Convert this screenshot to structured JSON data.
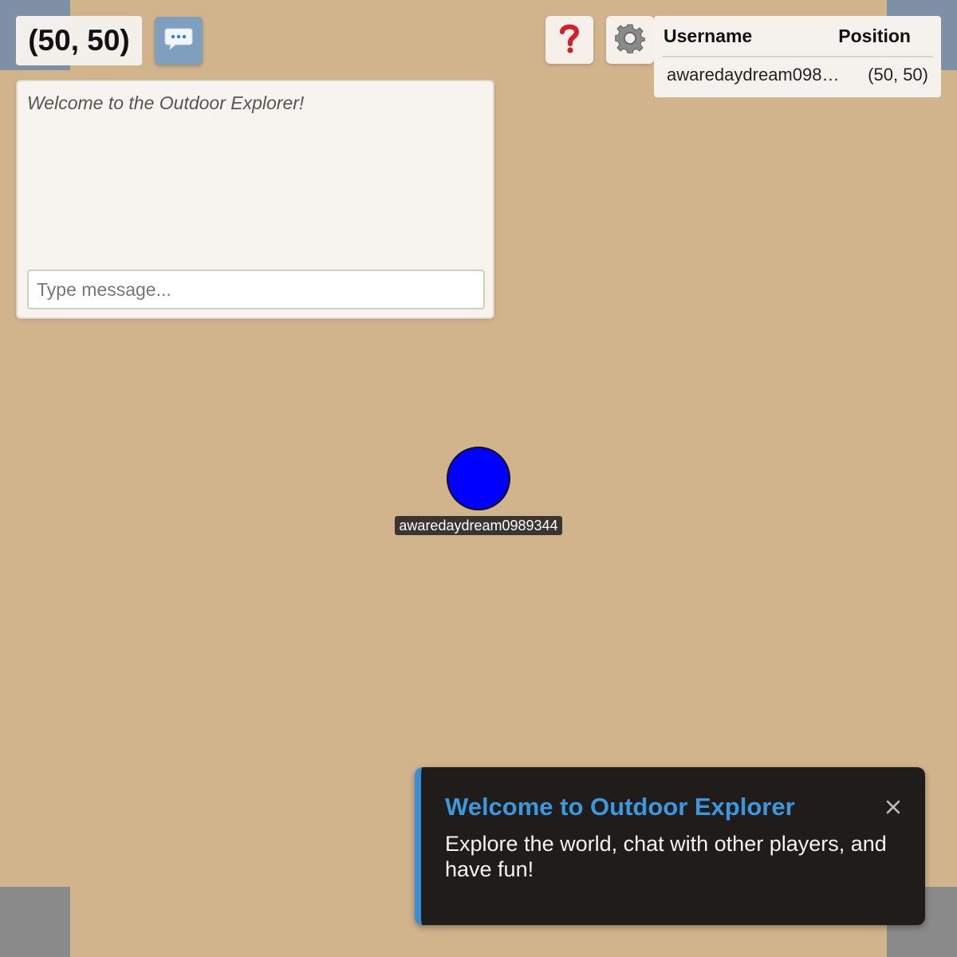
{
  "hud": {
    "coordinates": "(50, 50)"
  },
  "icons": {
    "chat": "chat-bubble-icon",
    "help": "question-mark-icon",
    "settings": "gear-icon",
    "close": "close-icon"
  },
  "players_table": {
    "headers": {
      "username": "Username",
      "position": "Position"
    },
    "rows": [
      {
        "username": "awaredaydream0989344",
        "position": "(50, 50)"
      }
    ]
  },
  "chat": {
    "welcome_message": "Welcome to the Outdoor Explorer!",
    "input_placeholder": "Type message...",
    "input_value": ""
  },
  "player": {
    "name": "awaredaydream0989344",
    "color": "#0000ff"
  },
  "toast": {
    "title": "Welcome to Outdoor Explorer",
    "message": "Explore the world, chat with other players, and have fun!",
    "accent_color": "#3a98de"
  },
  "colors": {
    "ground": "#d2b48c"
  }
}
